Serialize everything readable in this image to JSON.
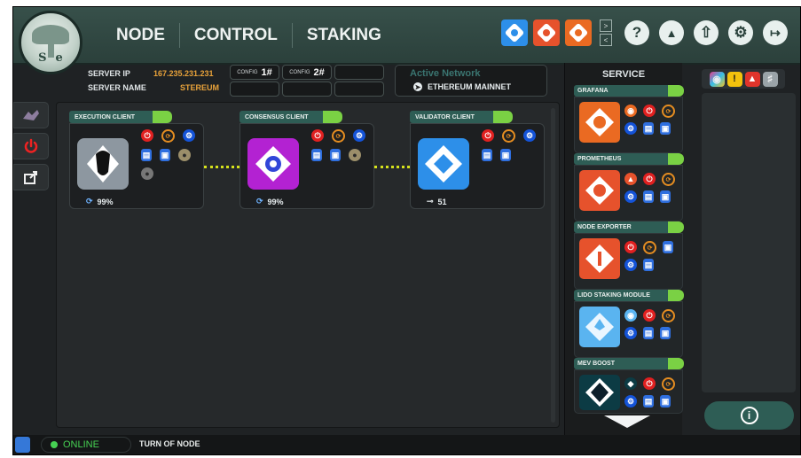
{
  "logo": {
    "letters": "Se"
  },
  "nav": {
    "tabs": [
      "NODE",
      "CONTROL",
      "STAKING"
    ]
  },
  "header_icons": [
    "plugin-icon",
    "update-icon",
    "grafana-icon",
    "help-icon",
    "announce-icon",
    "upload-icon",
    "settings-icon",
    "logout-icon"
  ],
  "server": {
    "ip_label": "SERVER IP",
    "ip_value": "167.235.231.231",
    "name_label": "SERVER NAME",
    "name_value": "STEREUM"
  },
  "configs": [
    {
      "label": "CONFIG",
      "value": "1#"
    },
    {
      "label": "CONFIG",
      "value": "2#"
    }
  ],
  "network": {
    "title": "Active Network",
    "value": "ETHEREUM MAINNET"
  },
  "clients": [
    {
      "title": "EXECUTION CLIENT",
      "status": "99%",
      "status_icon": "sync-icon",
      "image_color": "#8d97a0"
    },
    {
      "title": "CONSENSUS CLIENT",
      "status": "99%",
      "status_icon": "sync-icon",
      "image_color": "#b322d2"
    },
    {
      "title": "VALIDATOR CLIENT",
      "status": "51",
      "status_icon": "key-icon",
      "image_color": "#2d8fe9"
    }
  ],
  "service": {
    "title": "SERVICE",
    "items": [
      {
        "name": "GRAFANA",
        "color": "#ea6a22"
      },
      {
        "name": "PROMETHEUS",
        "color": "#e6522c"
      },
      {
        "name": "NODE EXPORTER",
        "color": "#e6522c"
      },
      {
        "name": "LIDO STAKING MODULE",
        "color": "#5ab4f0"
      },
      {
        "name": "MEV BOOST",
        "color": "#0c3b44"
      }
    ]
  },
  "colors": {
    "accent": "#2e5d55",
    "toggle_on": "#7ad144",
    "online": "#46d153",
    "connector": "#d6e21c"
  },
  "footer": {
    "status": "ONLINE",
    "action": "TURN OF NODE"
  }
}
